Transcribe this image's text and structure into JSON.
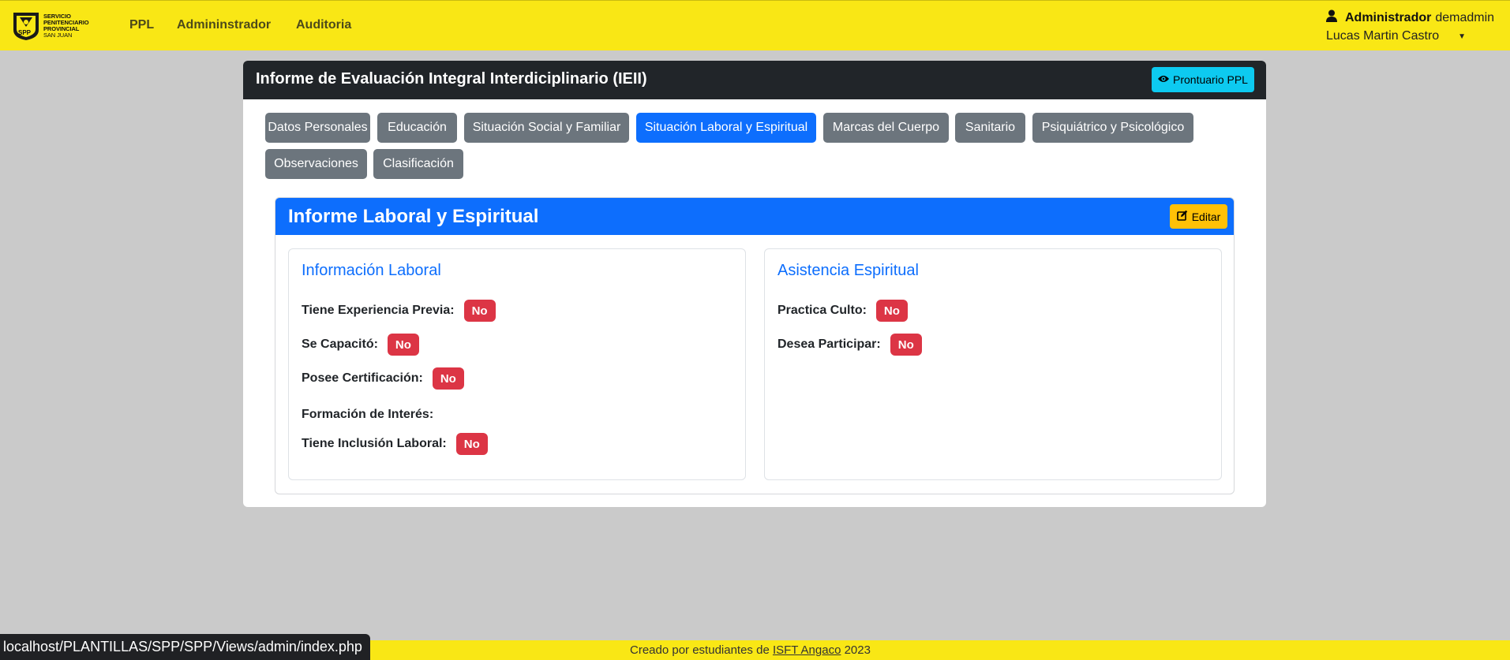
{
  "navbar": {
    "logo_text": [
      "Servicio",
      "Penitenciario",
      "Provincial",
      "San Juan"
    ],
    "logo_abbr": "SPP",
    "links": [
      "PPL",
      "Admininstrador",
      "Auditoria"
    ],
    "user": {
      "role": "Administrador",
      "username": "demadmin",
      "full_name": "Lucas Martin Castro"
    }
  },
  "card": {
    "title": "Informe de Evaluación Integral Interdiciplinario (IEII)",
    "prontuario_button": "Prontuario PPL"
  },
  "tabs": [
    {
      "label": "Datos Personales",
      "active": false
    },
    {
      "label": "Educación",
      "active": false
    },
    {
      "label": "Situación Social y Familiar",
      "active": false
    },
    {
      "label": "Situación Laboral y Espiritual",
      "active": true
    },
    {
      "label": "Marcas del Cuerpo",
      "active": false
    },
    {
      "label": "Sanitario",
      "active": false
    },
    {
      "label": "Psiquiátrico y Psicológico",
      "active": false
    },
    {
      "label": "Observaciones",
      "active": false
    },
    {
      "label": "Clasificación",
      "active": false
    }
  ],
  "report": {
    "title": "Informe Laboral y Espiritual",
    "edit_button": "Editar",
    "laboral": {
      "title": "Información Laboral",
      "fields": [
        {
          "label": "Tiene Experiencia Previa:",
          "value": "No"
        },
        {
          "label": "Se Capacitó:",
          "value": "No"
        },
        {
          "label": "Posee Certificación:",
          "value": "No"
        },
        {
          "label": "Formación de Interés:",
          "value": ""
        },
        {
          "label": "Tiene Inclusión Laboral:",
          "value": "No"
        }
      ]
    },
    "espiritual": {
      "title": "Asistencia Espiritual",
      "fields": [
        {
          "label": "Practica Culto:",
          "value": "No"
        },
        {
          "label": "Desea Participar:",
          "value": "No"
        }
      ]
    }
  },
  "footer": {
    "prefix": "Creado por estudiantes de",
    "link": "ISFT Angaco",
    "year": "2023"
  },
  "status_bar_url": "localhost/PLANTILLAS/SPP/SPP/Views/admin/index.php",
  "colors": {
    "brand_yellow": "#f9e715",
    "primary": "#0d6efd",
    "secondary": "#6c757d",
    "danger": "#dc3545",
    "info": "#0dcaf0",
    "warning": "#ffc107",
    "dark": "#212529"
  }
}
